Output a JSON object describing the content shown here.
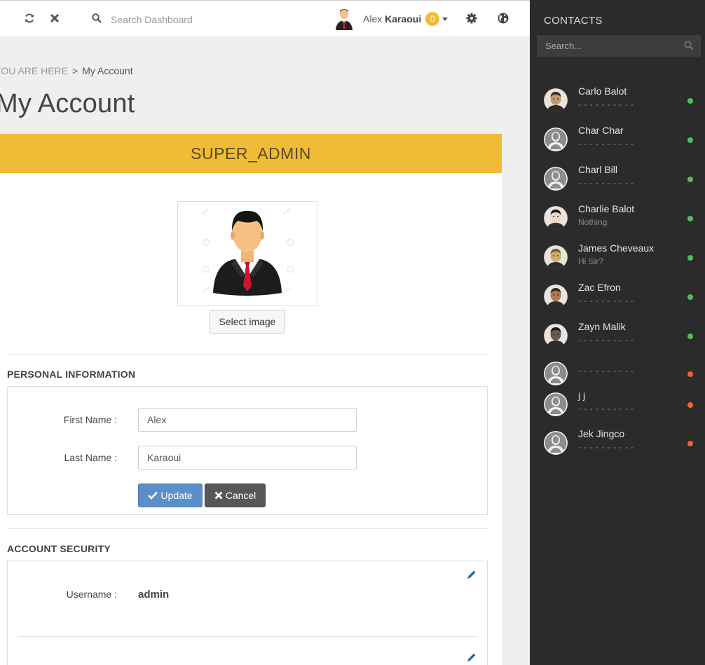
{
  "topbar": {
    "search_placeholder": "Search Dashboard",
    "user_first": "Alex",
    "user_last": "Karaoui",
    "notification_count": "0"
  },
  "breadcrumb": {
    "prefix": "YOU ARE HERE",
    "separator": ">",
    "current": "My Account"
  },
  "page_title": "My Account",
  "role_banner": "SUPER_ADMIN",
  "select_image_label": "Select image",
  "personal_info": {
    "title": "PERSONAL INFORMATION",
    "first_name_label": "First Name :",
    "first_name_value": "Alex",
    "last_name_label": "Last Name :",
    "last_name_value": "Karaoui",
    "update_label": "Update",
    "cancel_label": "Cancel"
  },
  "account_security": {
    "title": "ACCOUNT SECURITY",
    "username_label": "Username :",
    "username_value": "admin"
  },
  "sidebar": {
    "title": "CONTACTS",
    "search_placeholder": "Search...",
    "contacts": [
      {
        "name": "Carlo Balot",
        "status": "- - - - - - - - - -",
        "online": true,
        "photo": "photo"
      },
      {
        "name": "Char Char",
        "status": "- - - - - - - - - -",
        "online": true,
        "photo": "default"
      },
      {
        "name": "Charl Bill",
        "status": "- - - - - - - - - -",
        "online": true,
        "photo": "default"
      },
      {
        "name": "Charlie Balot",
        "status": "Nothing",
        "online": true,
        "photo": "photo"
      },
      {
        "name": "James Cheveaux",
        "status": "Hi Sir?",
        "online": true,
        "photo": "photo"
      },
      {
        "name": "Zac Efron",
        "status": "- - - - - - - - - -",
        "online": true,
        "photo": "photo"
      },
      {
        "name": "Zayn Malik",
        "status": "- - - - - - - - - -",
        "online": true,
        "photo": "photo"
      },
      {
        "name": "",
        "status": "- - - - - - - - - -",
        "online": false,
        "photo": "default"
      },
      {
        "name": "j j",
        "status": "- - - - - - - - - -",
        "online": false,
        "photo": "default"
      },
      {
        "name": "Jek Jingco",
        "status": "- - - - - - - - - -",
        "online": false,
        "photo": "default"
      }
    ]
  },
  "colors": {
    "online": "#5cb85c",
    "offline": "#e8663d",
    "banner": "#f0bb37",
    "primary": "#5b8fc8"
  }
}
